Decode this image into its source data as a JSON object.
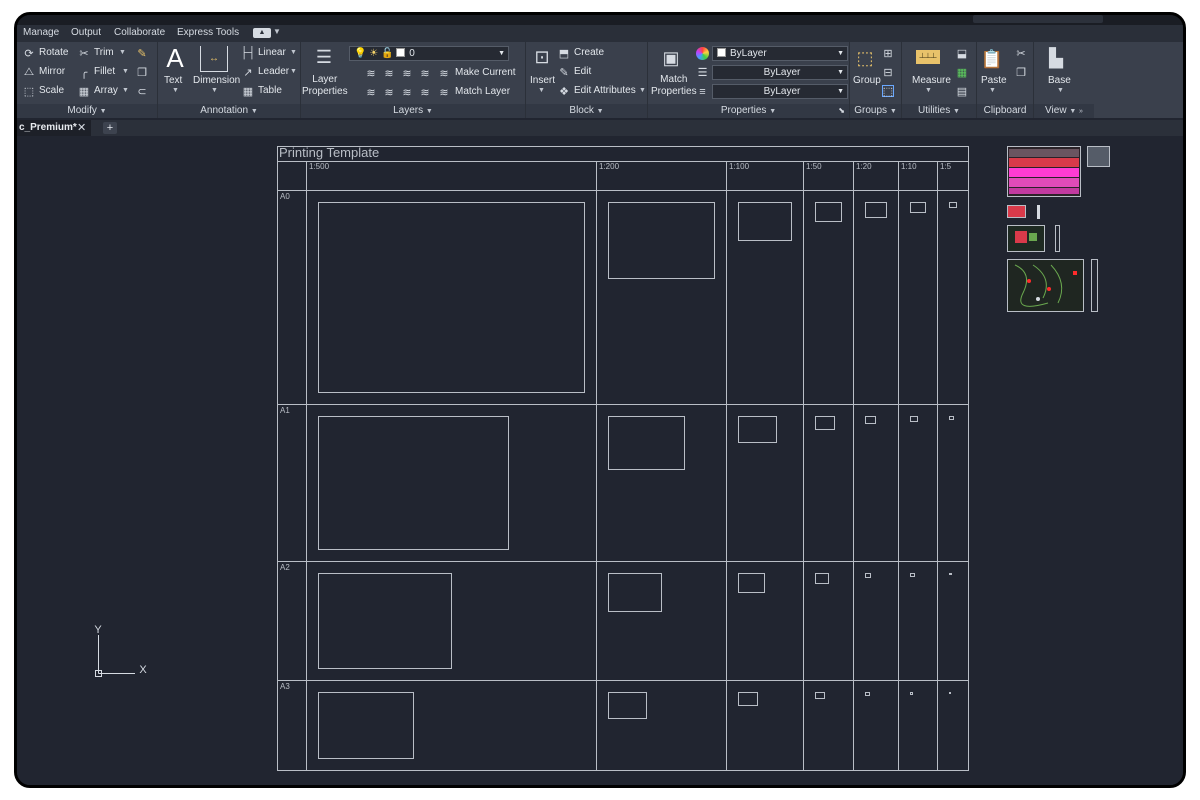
{
  "menu_tabs": [
    "Manage",
    "Output",
    "Collaborate",
    "Express Tools"
  ],
  "modify": {
    "title": "Modify",
    "rotate": "Rotate",
    "trim": "Trim",
    "mirror": "Mirror",
    "fillet": "Fillet",
    "scale": "Scale",
    "array": "Array"
  },
  "annotation": {
    "title": "Annotation",
    "text": "Text",
    "dimension": "Dimension",
    "linear": "Linear",
    "leader": "Leader",
    "table": "Table"
  },
  "layers": {
    "title": "Layers",
    "layer_properties": "Layer\nProperties",
    "current_layer": "0",
    "make_current": "Make Current",
    "match_layer": "Match Layer"
  },
  "block": {
    "title": "Block",
    "insert": "Insert",
    "create": "Create",
    "edit": "Edit",
    "edit_attributes": "Edit Attributes"
  },
  "properties": {
    "title": "Properties",
    "match_properties": "Match\nProperties",
    "color": "ByLayer",
    "linetype": "ByLayer",
    "lineweight": "ByLayer"
  },
  "groups": {
    "title": "Groups",
    "group": "Group"
  },
  "utilities": {
    "title": "Utilities",
    "measure": "Measure"
  },
  "clipboard": {
    "title": "Clipboard",
    "paste": "Paste"
  },
  "view": {
    "title": "View",
    "base": "Base"
  },
  "document_tab": "c_Premium*",
  "template": {
    "title": "Printing Template",
    "scales": [
      "1:500",
      "1:200",
      "1:100",
      "1:50",
      "1:20",
      "1:10",
      "1:5"
    ],
    "sheets": [
      "A0",
      "A1",
      "A2",
      "A3"
    ]
  },
  "ucs": {
    "x_label": "X",
    "y_label": "Y"
  },
  "colors": {
    "background": "#212530",
    "ribbon": "#3a404c",
    "line": "#b9bec6",
    "accent_red": "#ff2b2b",
    "accent_magenta": "#ff3cd2"
  }
}
